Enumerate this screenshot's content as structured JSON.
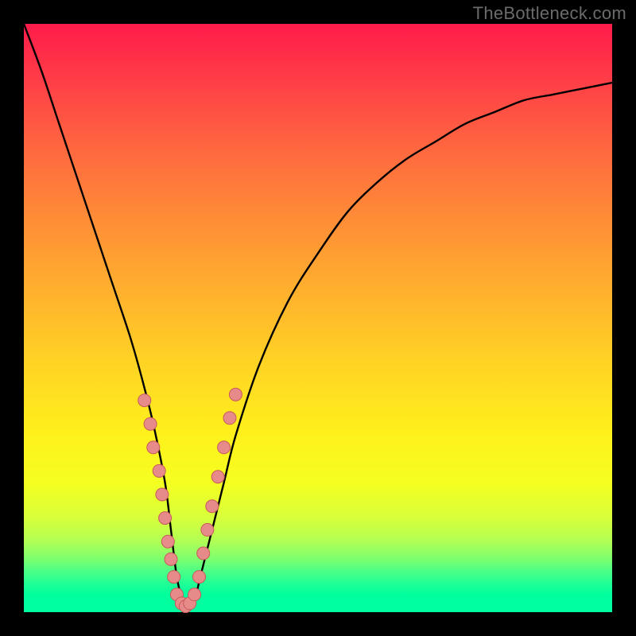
{
  "watermark": "TheBottleneck.com",
  "colors": {
    "curve_stroke": "#000000",
    "marker_fill": "#e68a8a",
    "marker_stroke": "#c95a5a",
    "background": "#000000"
  },
  "chart_data": {
    "type": "line",
    "title": "",
    "xlabel": "",
    "ylabel": "",
    "xlim": [
      0,
      100
    ],
    "ylim": [
      0,
      100
    ],
    "note": "No axis ticks or numeric labels are visible; values are normalized 0–100 estimates read from pixel positions. y=0 at bottom (green), y=100 at top (red). A single V-shaped curve with a cluster of circular markers near the trough.",
    "series": [
      {
        "name": "bottleneck-curve",
        "x": [
          0,
          3,
          6,
          9,
          12,
          15,
          18,
          20,
          22,
          24,
          25,
          26,
          27,
          28,
          29,
          30,
          32,
          34,
          36,
          40,
          45,
          50,
          55,
          60,
          65,
          70,
          75,
          80,
          85,
          90,
          95,
          100
        ],
        "y": [
          100,
          92,
          83,
          74,
          65,
          56,
          47,
          40,
          32,
          22,
          14,
          6,
          2,
          1,
          2,
          6,
          14,
          22,
          30,
          42,
          53,
          61,
          68,
          73,
          77,
          80,
          83,
          85,
          87,
          88,
          89,
          90
        ]
      }
    ],
    "markers": [
      {
        "x": 20.5,
        "y": 36
      },
      {
        "x": 21.5,
        "y": 32
      },
      {
        "x": 22.0,
        "y": 28
      },
      {
        "x": 23.0,
        "y": 24
      },
      {
        "x": 23.5,
        "y": 20
      },
      {
        "x": 24.0,
        "y": 16
      },
      {
        "x": 24.5,
        "y": 12
      },
      {
        "x": 25.0,
        "y": 9
      },
      {
        "x": 25.5,
        "y": 6
      },
      {
        "x": 26.0,
        "y": 3
      },
      {
        "x": 26.8,
        "y": 1.5
      },
      {
        "x": 27.5,
        "y": 1
      },
      {
        "x": 28.2,
        "y": 1.5
      },
      {
        "x": 29.0,
        "y": 3
      },
      {
        "x": 29.8,
        "y": 6
      },
      {
        "x": 30.5,
        "y": 10
      },
      {
        "x": 31.2,
        "y": 14
      },
      {
        "x": 32.0,
        "y": 18
      },
      {
        "x": 33.0,
        "y": 23
      },
      {
        "x": 34.0,
        "y": 28
      },
      {
        "x": 35.0,
        "y": 33
      },
      {
        "x": 36.0,
        "y": 37
      }
    ]
  }
}
